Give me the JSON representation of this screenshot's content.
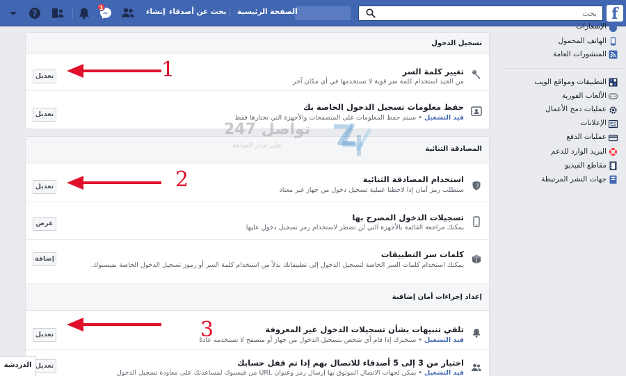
{
  "topbar": {
    "logo": "f",
    "search_placeholder": "بحث",
    "nav": {
      "home": "الصفحة الرئيسية",
      "find_friends": "بحث عن أصدقاء",
      "create": "إنشاء"
    },
    "messenger_badge": "1",
    "colors": {
      "bar": "#4267b2",
      "badge": "#fa3e3e"
    }
  },
  "sections": [
    {
      "title": "تسجيل الدخول",
      "rows": [
        {
          "icon": "key-icon",
          "title": "تغيير كلمة السر",
          "desc": "من الجيد استخدام كلمة سر قوية لا تستخدمها في أي مكان آخر",
          "status": "",
          "button": "تعديل"
        },
        {
          "icon": "id-card-icon",
          "title": "حفظ معلومات تسجيل الدخول الخاصة بك",
          "status": "قيد التشغيل",
          "desc": " • سيتم حفظ المعلومات على المتصفحات والأجهزة التي تختارها فقط",
          "button": "تعديل"
        }
      ]
    },
    {
      "title": "المصادقة الثنائية",
      "rows": [
        {
          "icon": "shield-icon",
          "title": "استخدام المصادقة الثنائية",
          "status": "",
          "desc": "ستطلب رمز أمان إذا لاحظنا عملية تسجيل دخول من جهاز غير معتاد",
          "button": "تعديل"
        },
        {
          "icon": "phone-icon",
          "title": "تسجيلات الدخول المصرح بها",
          "status": "",
          "desc": "يمكنك مراجعة القائمة بالأجهزة التي لن تضطر لاستخدام رمز تسجيل دخول عليها",
          "button": "عرض"
        },
        {
          "icon": "cube-icon",
          "title": "كلمات سر التطبيقات",
          "status": "",
          "desc": "يمكنك استخدام كلمات السر الخاصة لتسجيل الدخول إلى تطبيقاتك بدلاً من استخدام كلمة السر أو رموز تسجيل الدخول الخاصة بفيسبوك.",
          "button": "إضافة"
        }
      ]
    },
    {
      "title": "إعداد إجراءات أمان إضافية",
      "rows": [
        {
          "icon": "bell-icon",
          "title": "تلقي تنبيهات بشأن تسجيلات الدخول غير المعروفة",
          "status": "قيد التشغيل",
          "desc": " • سنخبرك إذا قام أي شخص بتسجيل الدخول من جهاز أو متصفح لا تستخدمه عادةً",
          "button": "تعديل"
        },
        {
          "icon": "friends-icon",
          "title": "اختيار من 3 إلى 5 أصدقاء للاتصال بهم إذا تم قفل حسابك",
          "status": "قيد التشغيل",
          "desc": " • يمكن لجهات الاتصال الموثوق بها إرسال رمز وعنوان URL من فيسبوك لمساعدتك على معاودة تسجيل الدخول",
          "button": "تعديل"
        }
      ]
    }
  ],
  "sidebar": {
    "items": [
      {
        "label": "الإشعارات",
        "icon": "globe-icon"
      },
      {
        "label": "الهاتف المحمول",
        "icon": "mobile-icon"
      },
      {
        "label": "المنشورات العامة",
        "icon": "rss-icon"
      },
      {
        "label": "التطبيقات ومواقع الويب",
        "icon": "apps-icon"
      },
      {
        "label": "الألعاب الفورية",
        "icon": "gamepad-icon"
      },
      {
        "label": "عمليات دمج الأعمال",
        "icon": "gear-icon"
      },
      {
        "label": "الإعلانات",
        "icon": "ads-icon"
      },
      {
        "label": "عمليات الدفع",
        "icon": "card-icon"
      },
      {
        "label": "البريد الوارد للدعم",
        "icon": "lifebuoy-icon"
      },
      {
        "label": "مقاطع الفيديو",
        "icon": "film-icon"
      },
      {
        "label": "جهات النشر المرتبطة",
        "icon": "book-icon"
      }
    ]
  },
  "watermark": {
    "text": "تواصل 247",
    "sub": "على مدار الساعة",
    "colors": {
      "logo": "#3a86c8"
    }
  },
  "annotations": {
    "n1": "1",
    "n2": "2",
    "n3": "3",
    "color": "#e0102b"
  },
  "chat": {
    "label": "الدردشة"
  }
}
